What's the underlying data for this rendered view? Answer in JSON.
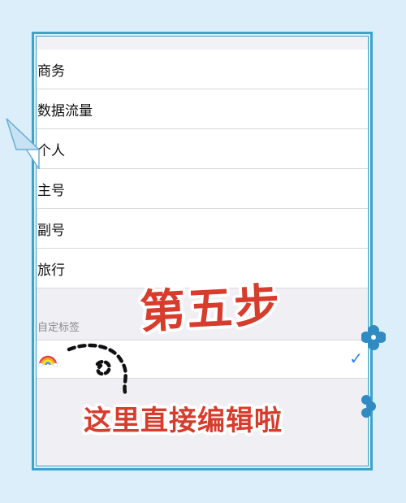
{
  "labels": {
    "items": [
      {
        "label": "商务"
      },
      {
        "label": "数据流量"
      },
      {
        "label": "个人"
      },
      {
        "label": "主号"
      },
      {
        "label": "副号"
      },
      {
        "label": "旅行"
      }
    ],
    "custom_section_header": "自定标签",
    "custom_item": {
      "emoji": "🌈",
      "selected": true,
      "check_icon": "checkmark-icon"
    }
  },
  "annotations": {
    "step_title": "第五步",
    "caption": "这里直接编辑啦"
  },
  "colors": {
    "background": "#dbeefa",
    "frame": "#3fa2c8",
    "accent_red": "#d73c2c",
    "checkmark_blue": "#2f7df6"
  }
}
